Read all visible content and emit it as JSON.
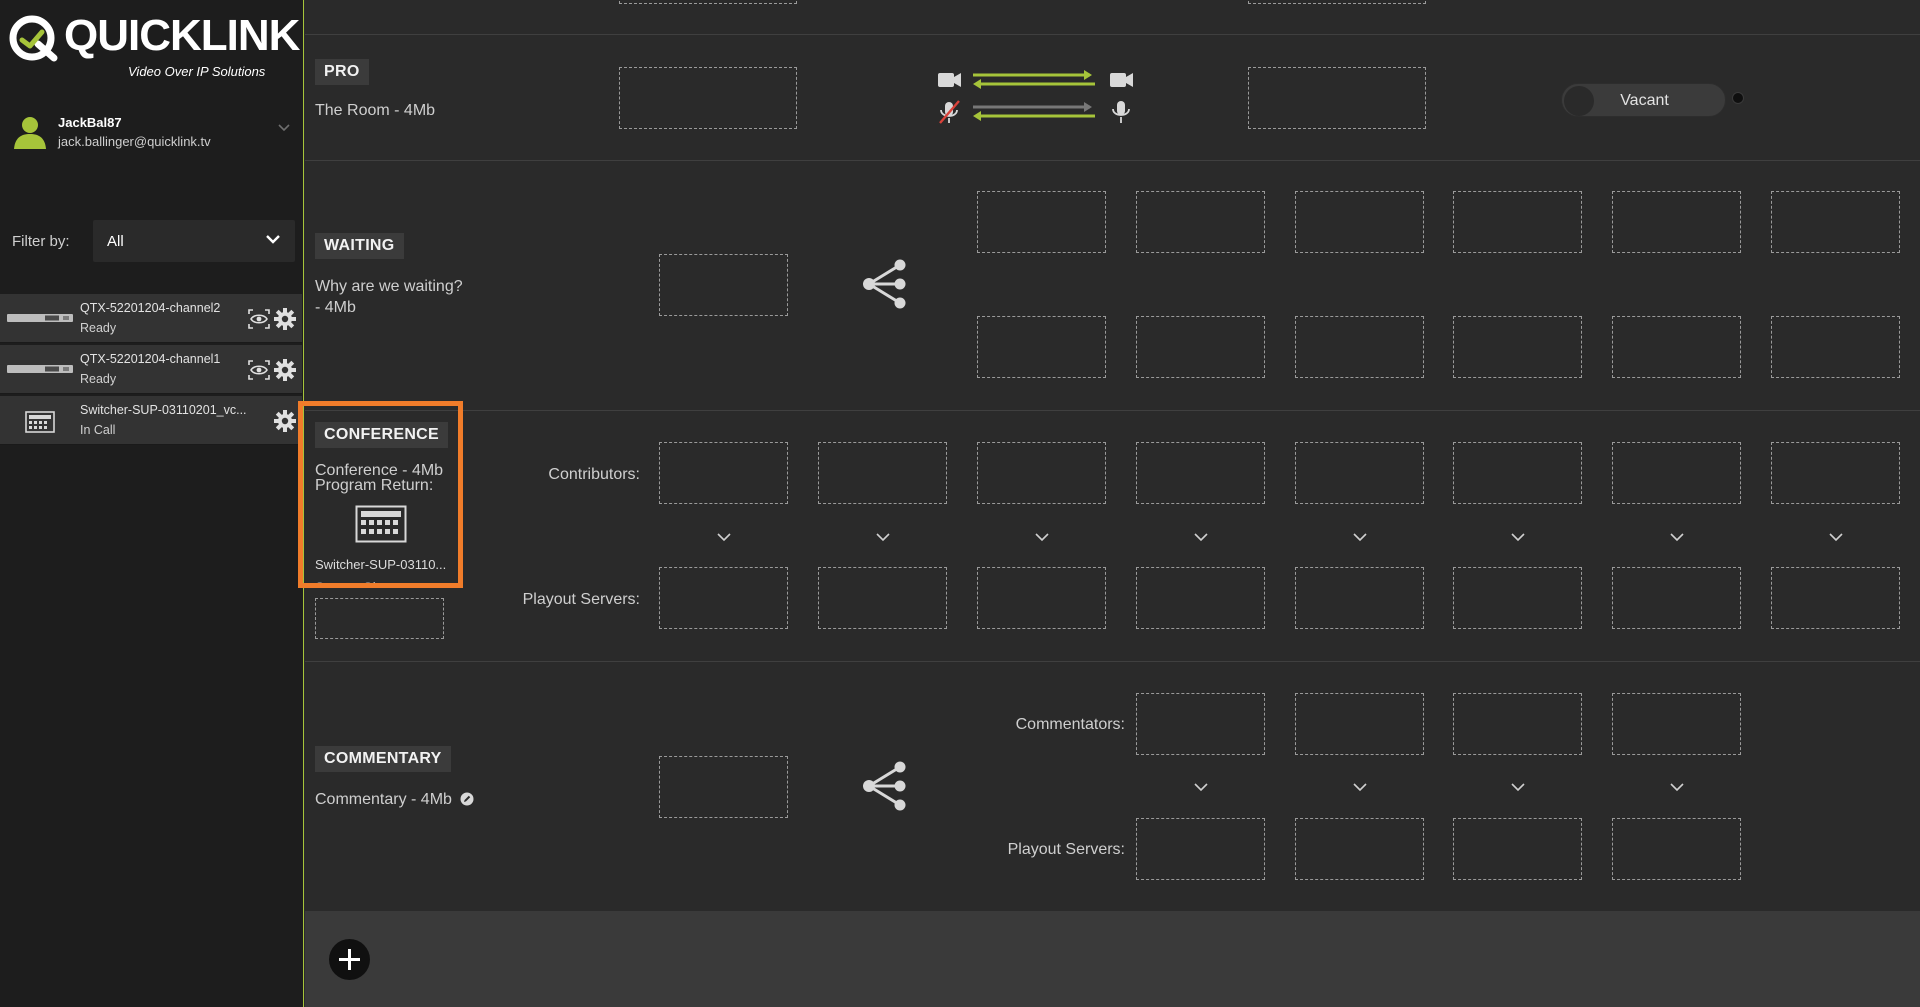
{
  "brand": {
    "name": "QUICKLINK",
    "tagline": "Video Over IP Solutions",
    "accent": "#a6c43a",
    "highlight": "#f07c2a"
  },
  "user": {
    "username": "JackBal87",
    "email": "jack.ballinger@quicklink.tv",
    "avatar_icon": "user-icon"
  },
  "filter": {
    "label": "Filter by:",
    "value": "All"
  },
  "devices": [
    {
      "name": "QTX-52201204-channel2",
      "status": "Ready",
      "icon": "qtx-device-icon"
    },
    {
      "name": "QTX-52201204-channel1",
      "status": "Ready",
      "icon": "qtx-device-icon"
    },
    {
      "name": "Switcher-SUP-03110201_vc...",
      "status": "In Call",
      "icon": "switcher-icon"
    }
  ],
  "sections": {
    "pro": {
      "tag": "PRO",
      "desc": "The Room - 4Mb",
      "toggle_label": "Vacant"
    },
    "waiting": {
      "tag": "WAITING",
      "desc_line1": "Why are we waiting?",
      "desc_line2": "- 4Mb"
    },
    "conference": {
      "tag": "CONFERENCE",
      "desc_line1": "Conference - 4Mb",
      "desc_line2": "Program Return:",
      "program_device": "Switcher-SUP-03110...",
      "screen_share_label": "Screen Share",
      "contributors_label": "Contributors:",
      "playout_label": "Playout Servers:"
    },
    "commentary": {
      "tag": "COMMENTARY",
      "desc": "Commentary - 4Mb",
      "commentators_label": "Commentators:",
      "playout_label": "Playout Servers:"
    }
  }
}
